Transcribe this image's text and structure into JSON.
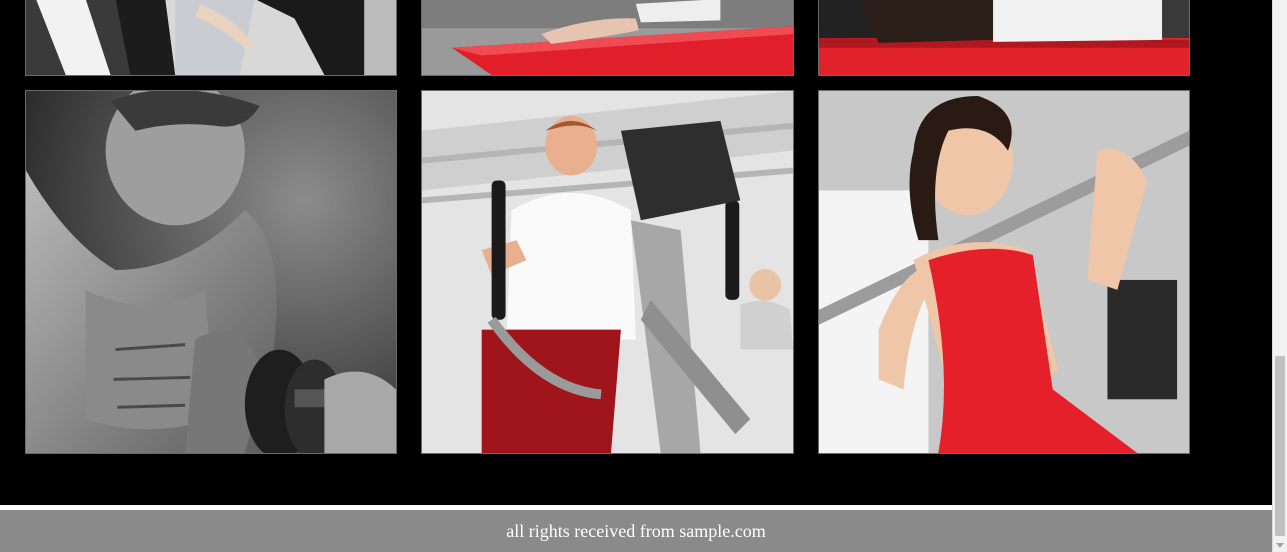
{
  "gallery": {
    "images": [
      {
        "name": "legs-stretching-photo"
      },
      {
        "name": "hand-on-red-mat-photo"
      },
      {
        "name": "person-lying-on-red-mat-photo"
      },
      {
        "name": "man-lifting-dumbbell-photo"
      },
      {
        "name": "man-on-elliptical-trainer-photo"
      },
      {
        "name": "woman-with-barbell-photo"
      }
    ]
  },
  "footer": {
    "text": "all rights received from sample.com"
  },
  "colors": {
    "page_background": "#000000",
    "footer_background": "#8a8a8a",
    "footer_text": "#ffffff",
    "accent_red": "#e5202a"
  }
}
